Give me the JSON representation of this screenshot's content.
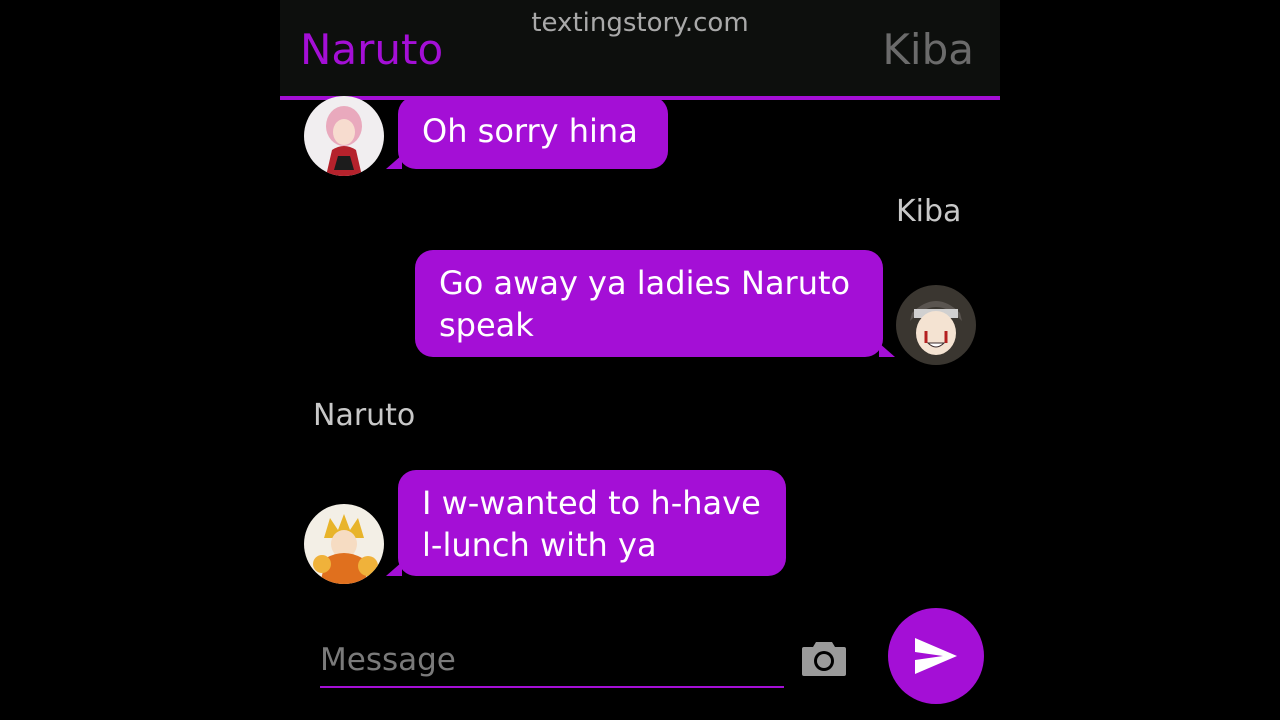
{
  "header": {
    "watermark": "textingstory.com",
    "left_name": "Naruto",
    "right_name": "Kiba"
  },
  "messages": [
    {
      "side": "left",
      "text": "Oh sorry hina",
      "avatar": "sakura-avatar"
    },
    {
      "side": "right",
      "sender": "Kiba",
      "text": "Go away ya ladies Naruto speak",
      "avatar": "kiba-avatar"
    },
    {
      "side": "left",
      "sender": "Naruto",
      "text": "I w-wanted to h-have l-lunch with ya",
      "avatar": "naruto-avatar"
    }
  ],
  "composer": {
    "placeholder": "Message",
    "camera_icon": "camera-icon",
    "send_icon": "send-icon"
  },
  "colors": {
    "accent": "#a40fd6",
    "header_bg": "#0d0f0d",
    "background": "#000000"
  }
}
